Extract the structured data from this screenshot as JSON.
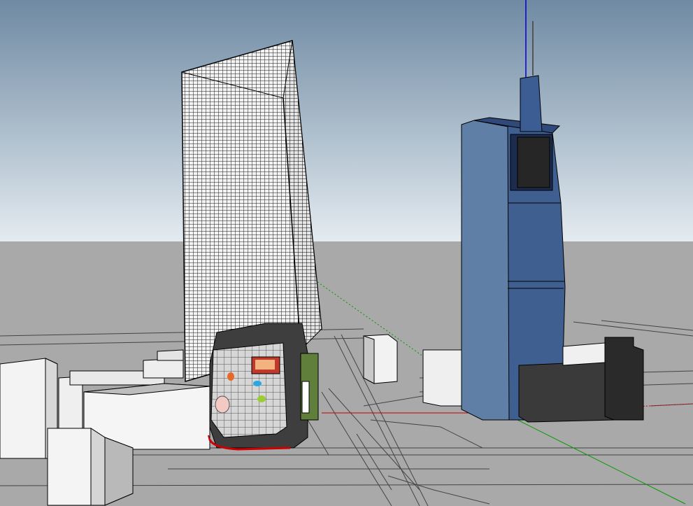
{
  "app": {
    "title": "",
    "mode": "3d-model-viewport"
  },
  "viewport": {
    "sky_top": "#6f8aa3",
    "sky_bottom": "#dfe7ee",
    "ground": "#a9a9a9",
    "axis_colors": {
      "x": "#cc0000",
      "y": "#009900",
      "z": "#0000cc"
    }
  },
  "scene": {
    "objects": [
      {
        "name": "glass-tower"
      },
      {
        "name": "blue-tower"
      },
      {
        "name": "podium-mall"
      },
      {
        "name": "low-rise-blocks"
      },
      {
        "name": "road-network"
      }
    ]
  }
}
